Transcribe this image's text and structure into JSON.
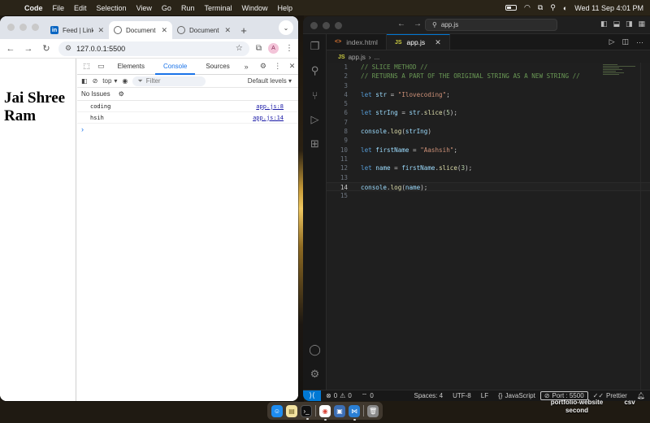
{
  "menubar": {
    "app_name": "Code",
    "items": [
      "File",
      "Edit",
      "Selection",
      "View",
      "Go",
      "Run",
      "Terminal",
      "Window",
      "Help"
    ],
    "clock": "Wed 11 Sep  4:01 PM"
  },
  "chrome": {
    "tabs": [
      {
        "label": "Feed | LinkedIn",
        "icon": "linkedin-icon"
      },
      {
        "label": "Document",
        "icon": "globe-icon"
      },
      {
        "label": "Document",
        "icon": "globe-icon"
      }
    ],
    "url": "127.0.0.1:5500",
    "avatar_letter": "A",
    "page_heading": "Jai Shree Ram"
  },
  "devtools": {
    "tabs": [
      "Elements",
      "Console",
      "Sources"
    ],
    "active_tab": "Console",
    "context": "top",
    "filter_placeholder": "Filter",
    "levels": "Default levels",
    "issues": "No Issues",
    "logs": [
      {
        "text": "coding",
        "source": "app.js:8"
      },
      {
        "text": "hsih",
        "source": "app.js:14"
      }
    ]
  },
  "vscode": {
    "command_center": "app.js",
    "tabs": [
      {
        "label": "index.html",
        "type": "html",
        "active": false
      },
      {
        "label": "app.js",
        "type": "js",
        "active": true
      }
    ],
    "breadcrumb": {
      "file": "app.js",
      "rest": "..."
    },
    "current_line": 14,
    "status": {
      "errors": "0",
      "warnings": "0",
      "ports": "0",
      "spaces": "Spaces: 4",
      "encoding": "UTF-8",
      "eol": "LF",
      "language": "JavaScript",
      "port": "Port : 5500",
      "prettier": "Prettier"
    }
  },
  "code_lines": [
    "// SLICE METHOD //",
    "// RETURNS A PART OF THE ORIGINAL STRING AS A NEW STRING //",
    "",
    "let str = \"Ilovecoding\";",
    "",
    "let strIng = str.slice(5);",
    "",
    "console.log(strIng)",
    "",
    "let firstName = \"Aashsih\";",
    "",
    "let name = firstName.slice(3);",
    "",
    "console.log(name);",
    ""
  ],
  "desktop_labels": [
    {
      "text": "portfolio-website second"
    },
    {
      "text": "csv"
    }
  ]
}
